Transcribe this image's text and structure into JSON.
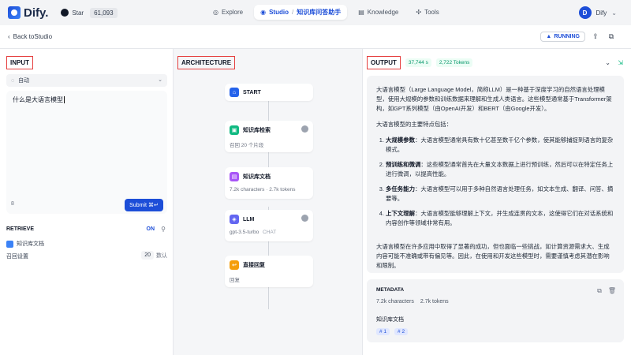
{
  "colors": {
    "accent": "#1d4ed8",
    "red_label": "#e53e3e",
    "green": "#059669"
  },
  "topbar": {
    "brand": "Dify.",
    "github": {
      "label": "Star",
      "count": "61,093"
    },
    "nav": [
      {
        "label": "Explore",
        "icon": "compass-icon"
      },
      {
        "label": "Studio",
        "icon": "studio-icon",
        "app": "知识库问答助手"
      },
      {
        "label": "Knowledge",
        "icon": "book-icon"
      },
      {
        "label": "Tools",
        "icon": "tools-icon"
      }
    ],
    "user": {
      "initial": "D",
      "name": "Dify"
    }
  },
  "subbar": {
    "back_label": "Back toStudio",
    "status": "RUNNING"
  },
  "input": {
    "section_label": "INPUT",
    "mode": "自动",
    "query": "什么是大语言模型",
    "char_count": "8",
    "submit_label": "Submit",
    "submit_hint": "⌘↵",
    "retrieve": {
      "title": "RETRIEVE",
      "state": "ON",
      "kb_name": "知识库文档",
      "setting_label": "召回设置",
      "setting_value": "20",
      "setting_unit": "数认"
    }
  },
  "architecture": {
    "section_label": "ARCHITECTURE",
    "nodes": [
      {
        "title": "START",
        "sub": "",
        "tag": "",
        "icon": "home-icon",
        "color": "#2563eb"
      },
      {
        "title": "知识库检索",
        "sub": "召回 20 个片段",
        "tag": "",
        "icon": "database-icon",
        "color": "#10b981"
      },
      {
        "title": "知识库文档",
        "sub": "7.2k characters · 2.7k tokens",
        "tag": "",
        "icon": "document-icon",
        "color": "#a855f7"
      },
      {
        "title": "LLM",
        "sub": "gpt-3.5-turbo",
        "tag": "CHAT",
        "icon": "llm-icon",
        "color": "#6366f1"
      },
      {
        "title": "直接回复",
        "sub": "回复",
        "tag": "",
        "icon": "reply-icon",
        "color": "#f59e0b"
      }
    ]
  },
  "output": {
    "section_label": "OUTPUT",
    "time": "37,744 s",
    "tokens": "2,722 Tokens",
    "intro": "大语言模型（Large Language Model，简称LLM）是一种基于深度学习的自然语言处理模型，使用大规模的参数和训练数据来理解和生成人类语言。这些模型通常基于Transformer架构，如GPT系列模型（由OpenAI开发）和BERT（由Google开发）。",
    "features_heading": "大语言模型的主要特点包括：",
    "features": [
      {
        "title": "大规模参数",
        "text": "：大语言模型通常具有数十亿甚至数千亿个参数，使其能够捕捉到语言的复杂模式。"
      },
      {
        "title": "预训练和微调",
        "text": "：这些模型通常首先在大量文本数据上进行预训练，然后可以在特定任务上进行微调，以提高性能。"
      },
      {
        "title": "多任务能力",
        "text": "：大语言模型可以用于多种自然语言处理任务，如文本生成、翻译、问答、摘要等。"
      },
      {
        "title": "上下文理解",
        "text": "：大语言模型能够理解上下文，并生成连贯的文本，这使得它们在对话系统和内容创作等领域非常有用。"
      }
    ],
    "conclusion": "大语言模型在许多应用中取得了显著的成功，但也面临一些挑战，如计算资源需求大、生成内容可能不准确或带有偏见等。因此，在使用和开发这些模型时，需要谨慎考虑其潜在影响和限制。",
    "metadata": {
      "title": "METADATA",
      "characters": "7.2k characters",
      "tokens": "2.7k tokens",
      "kb": "知识库文档",
      "refs": [
        "# 1",
        "# 2"
      ]
    }
  }
}
